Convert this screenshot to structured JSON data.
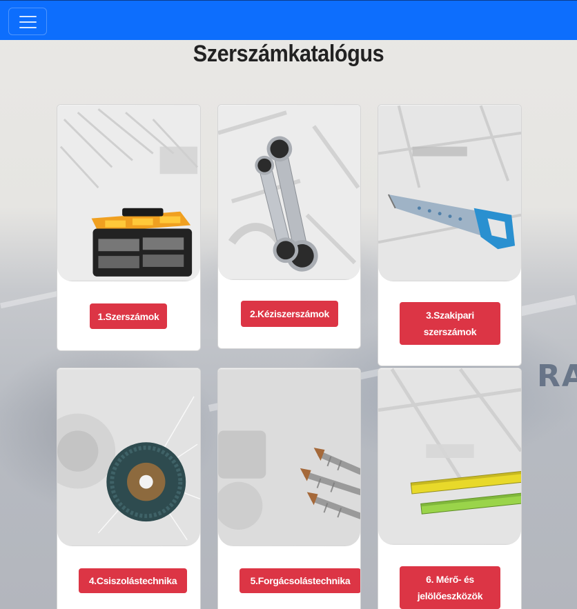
{
  "navbar": {
    "toggler_icon": "hamburger-icon",
    "color": "#0d6efd"
  },
  "page": {
    "title": "Szerszámkatalógus"
  },
  "categories": [
    {
      "label": "1.Szerszámok",
      "image": "toolbox-icon"
    },
    {
      "label": "2.Kéziszerszámok",
      "image": "ratchet-wrench-icon"
    },
    {
      "label": "3.Szakipari szerszámok",
      "image": "hand-saw-icon"
    },
    {
      "label": "4.Csiszolástechnika",
      "image": "flap-disc-icon"
    },
    {
      "label": "5.Forgácsolástechnika",
      "image": "drill-bits-icon"
    },
    {
      "label": "6. Mérő- és jelölőeszközök",
      "image": "spirit-level-icon"
    }
  ],
  "colors": {
    "button": "#dc3545",
    "accent": "#0d6efd"
  }
}
